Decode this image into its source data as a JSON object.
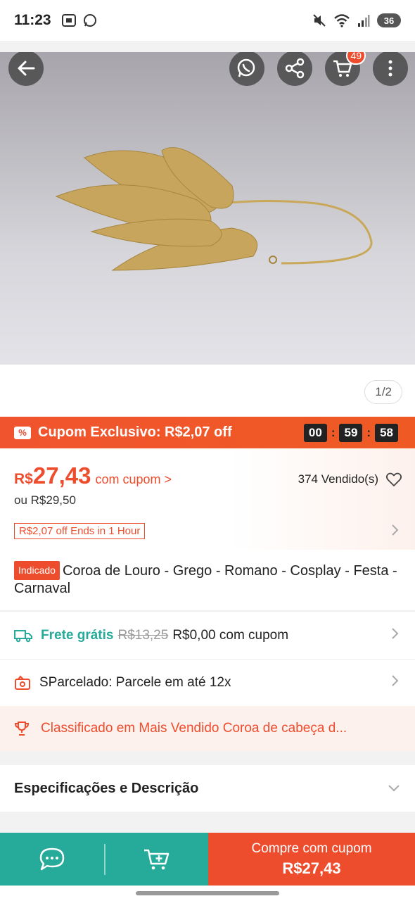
{
  "status_bar": {
    "time": "11:23",
    "battery": "36"
  },
  "image": {
    "cart_count": "49",
    "page_indicator": "1/2"
  },
  "coupon": {
    "label": "Cupom Exclusivo: R$2,07 off",
    "countdown": {
      "hours": "00",
      "minutes": "59",
      "seconds": "58"
    }
  },
  "price": {
    "currency": "R$",
    "value": "27,43",
    "coupon_link": "com cupom >",
    "original": "ou R$29,50",
    "sold": "374 Vendido(s)",
    "offer_tag": "R$2,07 off Ends in 1 Hour"
  },
  "product": {
    "badge": "Indicado",
    "title": "Coroa de Louro -  Grego - Romano - Cosplay - Festa - Carnaval"
  },
  "shipping": {
    "free_label": "Frete grátis",
    "old_price": "R$13,25",
    "new_price": "R$0,00 com cupom"
  },
  "installments": {
    "label": "SParcelado: Parcele em até 12x"
  },
  "ranking": {
    "label": "Classificado em Mais Vendido Coroa de cabeça d..."
  },
  "specs": {
    "label": "Especificações e Descrição"
  },
  "bottom_bar": {
    "buy_label": "Compre com cupom",
    "buy_price": "R$27,43"
  },
  "colors": {
    "accent": "#ee4d2d",
    "teal": "#26aa99"
  }
}
